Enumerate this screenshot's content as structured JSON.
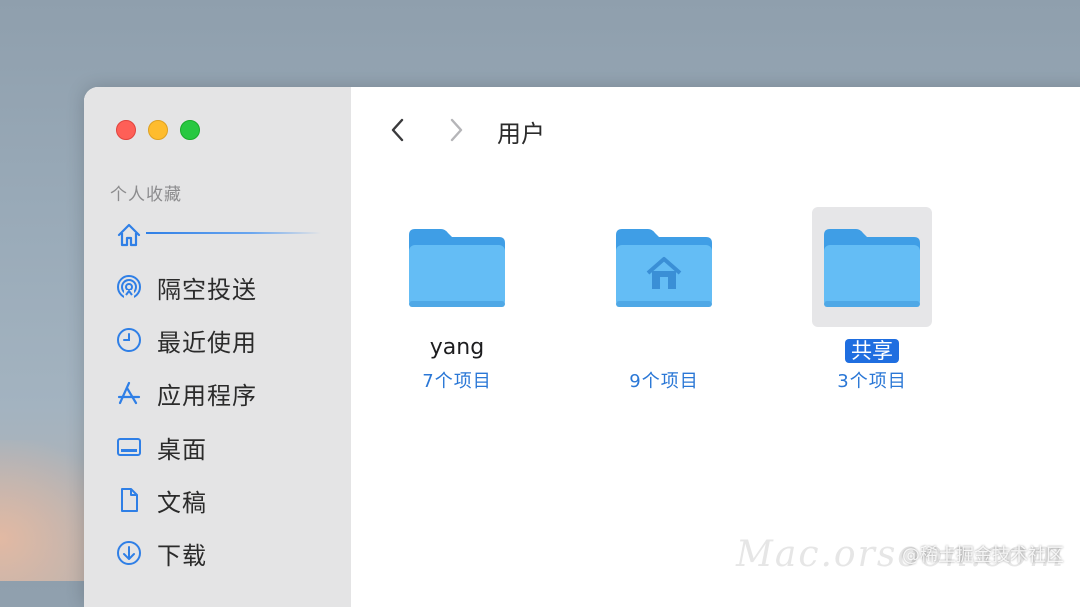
{
  "window": {
    "title": "用户"
  },
  "sidebar": {
    "section_label": "个人收藏",
    "items": [
      {
        "label": "",
        "icon": "home-icon"
      },
      {
        "label": "隔空投送",
        "icon": "airdrop-icon"
      },
      {
        "label": "最近使用",
        "icon": "clock-icon"
      },
      {
        "label": "应用程序",
        "icon": "apps-icon"
      },
      {
        "label": "桌面",
        "icon": "desktop-icon"
      },
      {
        "label": "文稿",
        "icon": "document-icon"
      },
      {
        "label": "下载",
        "icon": "download-icon"
      }
    ]
  },
  "folders": [
    {
      "name": "yang",
      "count": "7个项目",
      "icon": "folder-icon"
    },
    {
      "name": "",
      "count": "9个项目",
      "icon": "home-folder-icon"
    },
    {
      "name": "共享",
      "count": "3个项目",
      "icon": "folder-icon",
      "selected": true
    }
  ],
  "colors": {
    "accent": "#1f6ee0",
    "folder": "#5ab8f3",
    "count_text": "#2a77d6"
  },
  "watermark": {
    "text": "@稀土掘金技术社区",
    "brand": "Mac.orsoon.com"
  }
}
